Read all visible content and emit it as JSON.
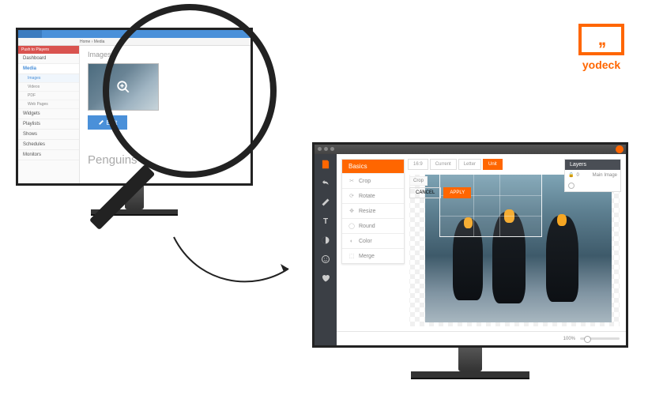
{
  "brand": {
    "name": "yodeck",
    "accent": "#ff6600"
  },
  "left_app": {
    "push_button": "Push to Players",
    "breadcrumb": "Home  ›  Media",
    "sidebar": {
      "items": [
        {
          "label": "Dashboard"
        },
        {
          "label": "Media",
          "active": true,
          "children": [
            {
              "label": "Images",
              "active": true
            },
            {
              "label": "Videos"
            },
            {
              "label": "PDF"
            },
            {
              "label": "Web Pages"
            }
          ]
        },
        {
          "label": "Widgets"
        },
        {
          "label": "Playlists"
        },
        {
          "label": "Shows"
        },
        {
          "label": "Schedules"
        },
        {
          "label": "Monitors"
        }
      ]
    },
    "content_title": "Images",
    "edit_button": "Edit",
    "item_name": "Penguins"
  },
  "editor": {
    "panel_title": "Basics",
    "actions": [
      {
        "icon": "crop",
        "label": "Crop"
      },
      {
        "icon": "rotate",
        "label": "Rotate"
      },
      {
        "icon": "resize",
        "label": "Resize"
      },
      {
        "icon": "round",
        "label": "Round"
      },
      {
        "icon": "color",
        "label": "Color"
      },
      {
        "icon": "merge",
        "label": "Merge"
      }
    ],
    "option_tabs": [
      {
        "label": "16:9"
      },
      {
        "label": "Current"
      },
      {
        "label": "Letter"
      },
      {
        "label": "Unit",
        "active": true
      }
    ],
    "crop_label": "Crop",
    "crop_buttons": {
      "cancel": "CANCEL",
      "apply": "APPLY"
    },
    "layers": {
      "title": "Layers",
      "main_label": "Main Image",
      "lock_value": "0"
    },
    "toolbar": [
      {
        "name": "save",
        "label": "Save"
      },
      {
        "name": "undo",
        "label": ""
      },
      {
        "name": "pencil",
        "label": ""
      },
      {
        "name": "text",
        "label": "Text"
      },
      {
        "name": "contrast",
        "label": ""
      },
      {
        "name": "sticker",
        "label": "Stickers"
      },
      {
        "name": "heart",
        "label": ""
      }
    ],
    "zoom": "100%"
  }
}
